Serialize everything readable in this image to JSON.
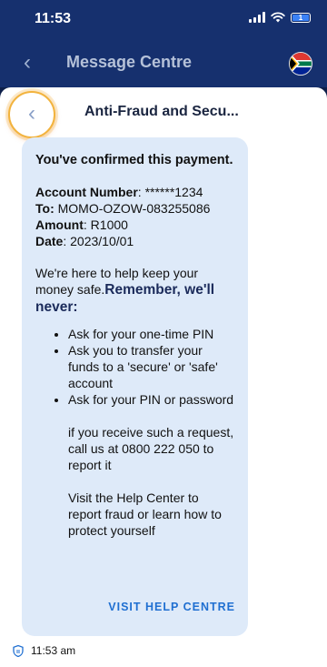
{
  "status": {
    "time": "11:53",
    "battery": "1"
  },
  "header": {
    "back_icon": "chevron-left-icon",
    "title": "Message Centre",
    "flag_icon": "south-africa-flag-icon"
  },
  "thread": {
    "back_icon": "chevron-left-icon",
    "title": "Anti-Fraud and Secu..."
  },
  "message": {
    "heading": "You've confirmed this payment.",
    "account_label": "Account Number",
    "account_value": ": ******1234",
    "to_label": "To:",
    "to_value": " MOMO-OZOW-083255086",
    "amount_label": "Amount",
    "amount_value": ": R1000",
    "date_label": "Date",
    "date_value": ": 2023/10/01",
    "intro": "We're here to help keep your money safe.",
    "remember": "Remember, we'll never:",
    "never_items": [
      "Ask for your one-time PIN",
      "Ask you to transfer your funds to a 'secure' or 'safe' account",
      "Ask for your PIN or password"
    ],
    "call_note": "if you receive such a request, call us at 0800 222 050 to report it",
    "help_note": "Visit the Help Center to report fraud or learn how to protect yourself",
    "cta_label": "VISIT HELP CENTRE"
  },
  "meta": {
    "sender_icon": "bank-shield-icon",
    "timestamp": "11:53 am"
  },
  "colors": {
    "header_bg": "#16306e",
    "bubble_bg": "#deeaf9",
    "accent_link": "#1f6fd1",
    "highlight_ring": "#f2b33d"
  }
}
